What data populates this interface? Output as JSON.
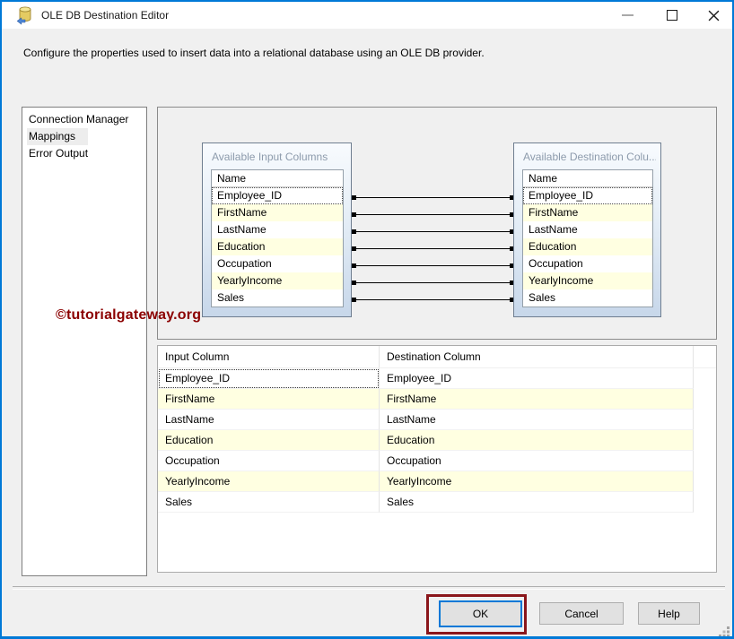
{
  "window": {
    "title": "OLE DB Destination Editor",
    "description": "Configure the properties used to insert data into a relational database using an OLE DB provider."
  },
  "icons": {
    "title_icon": "database-destination-icon",
    "minimize": "minimize-icon",
    "maximize": "maximize-icon",
    "close": "close-icon",
    "resize_grip": "resize-grip-icon"
  },
  "sidebar": {
    "items": [
      {
        "label": "Connection Manager",
        "selected": false
      },
      {
        "label": "Mappings",
        "selected": true
      },
      {
        "label": "Error Output",
        "selected": false
      }
    ]
  },
  "diagram": {
    "input_box": {
      "title": "Available Input Columns",
      "list_header": "Name",
      "items": [
        "Employee_ID",
        "FirstName",
        "LastName",
        "Education",
        "Occupation",
        "YearlyIncome",
        "Sales"
      ]
    },
    "destination_box": {
      "title": "Available Destination Colu...",
      "list_header": "Name",
      "items": [
        "Employee_ID",
        "FirstName",
        "LastName",
        "Education",
        "Occupation",
        "YearlyIncome",
        "Sales"
      ]
    },
    "connections": [
      {
        "from": "Employee_ID",
        "to": "Employee_ID"
      },
      {
        "from": "FirstName",
        "to": "FirstName"
      },
      {
        "from": "LastName",
        "to": "LastName"
      },
      {
        "from": "Education",
        "to": "Education"
      },
      {
        "from": "Occupation",
        "to": "Occupation"
      },
      {
        "from": "YearlyIncome",
        "to": "YearlyIncome"
      },
      {
        "from": "Sales",
        "to": "Sales"
      }
    ]
  },
  "mapping_table": {
    "headers": [
      "Input Column",
      "Destination Column"
    ],
    "rows": [
      {
        "input": "Employee_ID",
        "destination": "Employee_ID"
      },
      {
        "input": "FirstName",
        "destination": "FirstName"
      },
      {
        "input": "LastName",
        "destination": "LastName"
      },
      {
        "input": "Education",
        "destination": "Education"
      },
      {
        "input": "Occupation",
        "destination": "Occupation"
      },
      {
        "input": "YearlyIncome",
        "destination": "YearlyIncome"
      },
      {
        "input": "Sales",
        "destination": "Sales"
      }
    ]
  },
  "watermark": "©tutorialgateway.org",
  "buttons": {
    "ok": "OK",
    "cancel": "Cancel",
    "help": "Help"
  },
  "colors": {
    "window_border": "#0079D7",
    "accent_blue": "#0078D7",
    "row_highlight_yellow": "#FFFFE1",
    "annotation_red": "#8A161B",
    "watermark_red": "#8B0000"
  }
}
